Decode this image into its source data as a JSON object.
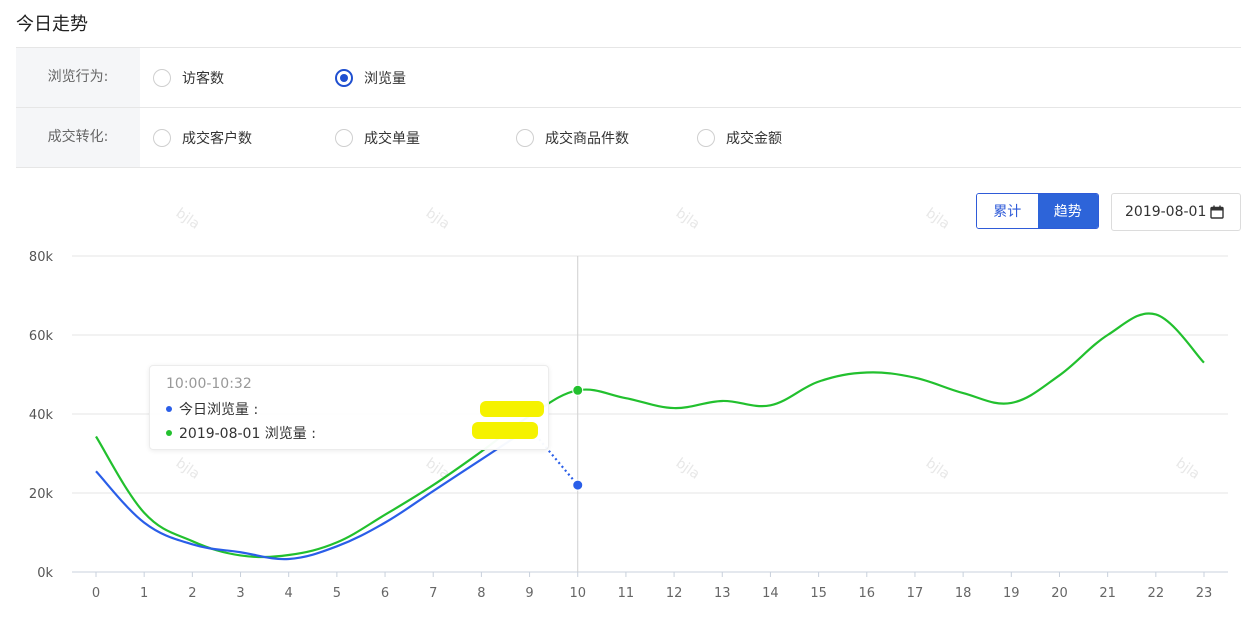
{
  "page": {
    "title": "今日走势"
  },
  "filters": {
    "rows": [
      {
        "label": "浏览行为:",
        "options": [
          {
            "label": "访客数",
            "checked": false
          },
          {
            "label": "浏览量",
            "checked": true
          }
        ]
      },
      {
        "label": "成交转化:",
        "options": [
          {
            "label": "成交客户数",
            "checked": false
          },
          {
            "label": "成交单量",
            "checked": false
          },
          {
            "label": "成交商品件数",
            "checked": false
          },
          {
            "label": "成交金额",
            "checked": false
          }
        ]
      }
    ]
  },
  "controls": {
    "toggle": [
      {
        "label": "累计",
        "active": false
      },
      {
        "label": "趋势",
        "active": true
      }
    ],
    "date": "2019-08-01",
    "date_icon": "calendar-icon"
  },
  "watermark": "bjla",
  "tooltip": {
    "title": "10:00-10:32",
    "rows": [
      {
        "label": "今日浏览量",
        "color": "#2a5ee8"
      },
      {
        "label": "2019-08-01 浏览量",
        "color": "#22c02e"
      }
    ]
  },
  "chart_data": {
    "type": "line",
    "x": [
      0,
      1,
      2,
      3,
      4,
      5,
      6,
      7,
      8,
      9,
      10,
      11,
      12,
      13,
      14,
      15,
      16,
      17,
      18,
      19,
      20,
      21,
      22,
      23
    ],
    "ylim": [
      0,
      80000
    ],
    "yticks": [
      0,
      20000,
      40000,
      60000,
      80000
    ],
    "ytick_labels": [
      "0k",
      "20k",
      "40k",
      "60k",
      "80k"
    ],
    "grid": true,
    "hover_x": 10,
    "series": [
      {
        "name": "今日浏览量",
        "color": "#2a5ee8",
        "values": [
          25500,
          12500,
          7000,
          5000,
          3300,
          6500,
          12500,
          20500,
          28500,
          36500,
          22000
        ],
        "dotted_last_segment": true
      },
      {
        "name": "2019-08-01 浏览量",
        "color": "#22c02e",
        "values": [
          34300,
          15000,
          7800,
          4200,
          4300,
          7500,
          14500,
          22000,
          30500,
          39500,
          46000,
          44000,
          41500,
          43300,
          42200,
          48200,
          50500,
          49200,
          45300,
          42800,
          49800,
          60000,
          65200,
          53000
        ]
      }
    ]
  }
}
